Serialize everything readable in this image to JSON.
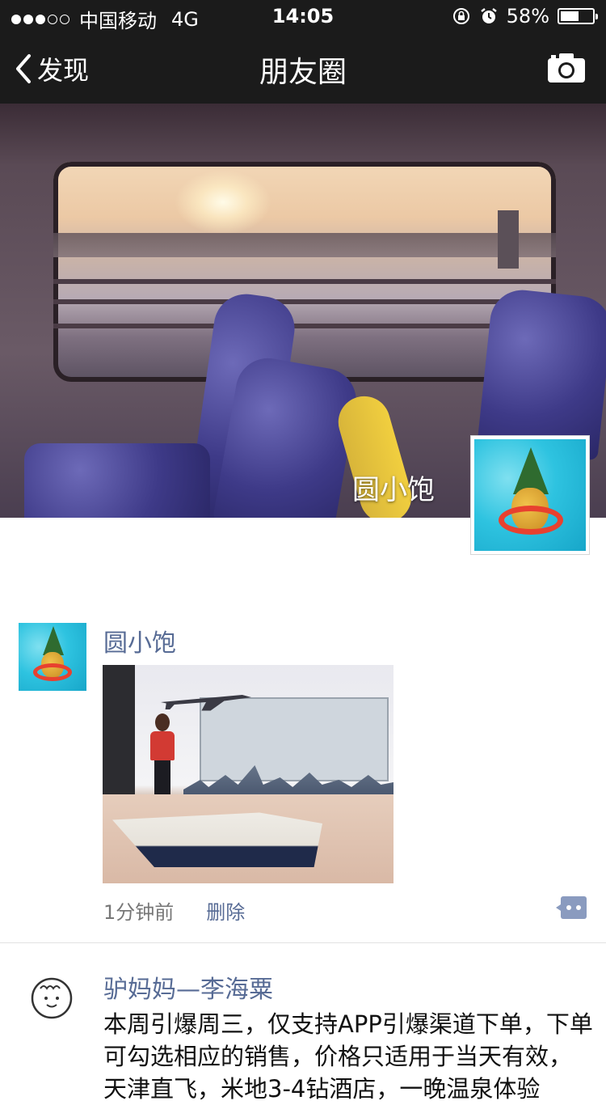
{
  "status_bar": {
    "signal_dots_filled": 3,
    "signal_dots_total": 5,
    "carrier": "中国移动",
    "network": "4G",
    "time": "14:05",
    "battery_percent": "58%",
    "battery_level": 0.58
  },
  "nav": {
    "back_label": "发现",
    "title": "朋友圈"
  },
  "cover": {
    "user_name": "圆小饱"
  },
  "posts": [
    {
      "author": "圆小饱",
      "time": "1分钟前",
      "delete_label": "删除"
    },
    {
      "author": "驴妈妈—李海粟",
      "text": "本周引爆周三，仅支持APP引爆渠道下单，下单可勾选相应的销售，价格只适用于当天有效，天津直飞，米地3-4钻酒店，一晚温泉体验"
    }
  ],
  "colors": {
    "bar_bg": "#1b1b1b",
    "link_blue": "#576b95",
    "meta_gray": "#777777"
  }
}
